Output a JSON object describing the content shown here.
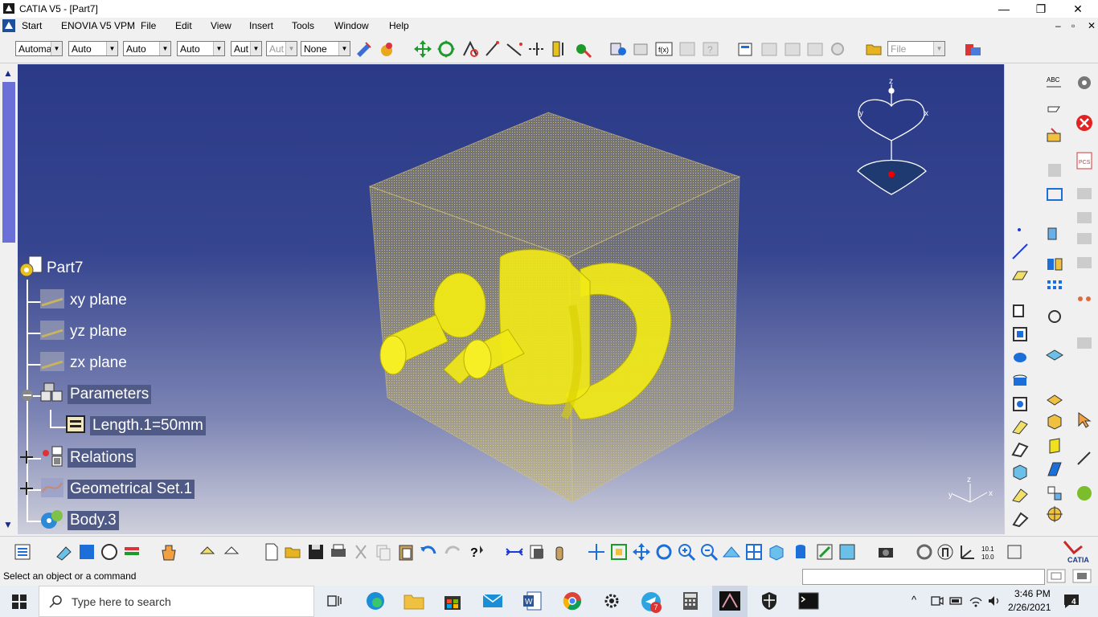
{
  "window": {
    "title": "CATIA V5 - [Part7]",
    "min": "—",
    "max": "❐",
    "close": "✕"
  },
  "menu": {
    "items": [
      "Start",
      "ENOVIA V5 VPM",
      "File",
      "Edit",
      "View",
      "Insert",
      "Tools",
      "Window",
      "Help"
    ],
    "doc_controls": [
      "–",
      "▫",
      "✕"
    ]
  },
  "toolbar": {
    "combos": [
      "Automa",
      "Auto",
      "Auto",
      "Auto",
      "Aut",
      "Aut",
      "None"
    ],
    "file_combo": "File"
  },
  "tree": {
    "root": "Part7",
    "items": [
      {
        "label": "xy plane"
      },
      {
        "label": "yz plane"
      },
      {
        "label": "zx plane"
      },
      {
        "label": "Parameters"
      },
      {
        "label": "Length.1=50mm"
      },
      {
        "label": "Relations"
      },
      {
        "label": "Geometrical Set.1"
      },
      {
        "label": "Body.3"
      }
    ]
  },
  "compass": {
    "z": "z",
    "x": "x",
    "y": "y"
  },
  "axis_triad": {
    "x": "x",
    "y": "y",
    "z": "z"
  },
  "status": {
    "message": "Select an object or a command"
  },
  "taskbar": {
    "search_placeholder": "Type here to search",
    "time": "3:46 PM",
    "date": "2/26/2021",
    "notification_count": "4",
    "teams_badge": "7"
  },
  "colors": {
    "viewport_top": "#2b3a87",
    "part_yellow": "#f5ef1a",
    "box_tan": "#c8b35f",
    "scroll_thumb": "#6b6fd8"
  }
}
